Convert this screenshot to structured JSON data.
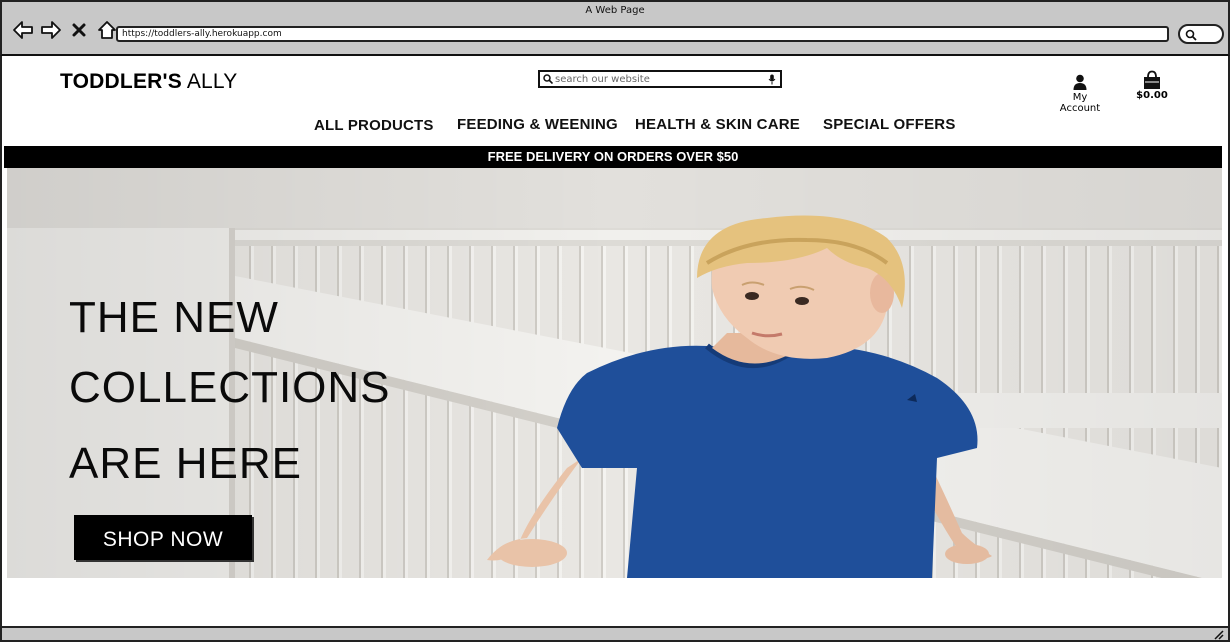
{
  "window": {
    "title": "A Web Page"
  },
  "browser": {
    "url": "https://toddlers-ally.herokuapp.com",
    "icons": [
      "back-arrow-icon",
      "forward-arrow-icon",
      "close-icon",
      "home-icon",
      "search-icon"
    ]
  },
  "header": {
    "logo_bold": "TODDLER'S",
    "logo_light": "ALLY",
    "search_placeholder": "search our website",
    "account_label": "My Account",
    "cart_total": "$0.00"
  },
  "nav": {
    "items": [
      {
        "label": "ALL PRODUCTS"
      },
      {
        "label": "FEEDING & WEENING"
      },
      {
        "label": "HEALTH & SKIN CARE"
      },
      {
        "label": "SPECIAL OFFERS"
      }
    ]
  },
  "banner": {
    "text": "FREE DELIVERY ON ORDERS OVER $50"
  },
  "hero": {
    "lines": [
      "THE NEW",
      "COLLECTIONS",
      "ARE HERE"
    ],
    "cta_label": "SHOP NOW"
  },
  "colors": {
    "chrome": "#c8c8c8",
    "banner_bg": "#000000",
    "shirt": "#1f4f9a"
  }
}
